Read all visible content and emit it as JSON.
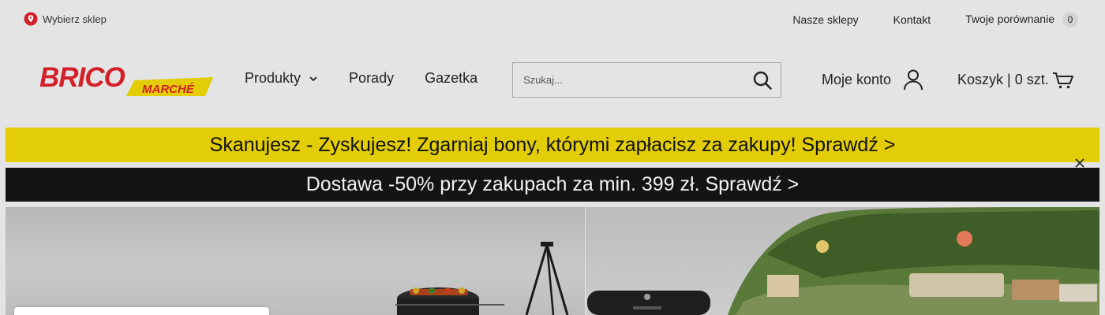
{
  "topbar": {
    "store_picker": "Wybierz sklep",
    "links": {
      "stores": "Nasze sklepy",
      "contact": "Kontakt",
      "compare": "Twoje porównanie",
      "compare_count": "0"
    }
  },
  "header": {
    "logo": {
      "text_main": "BRICO",
      "text_sub": "MARCHÉ"
    },
    "nav": {
      "products": "Produkty",
      "advice": "Porady",
      "leaflet": "Gazetka"
    },
    "search": {
      "placeholder": "Szukaj...",
      "value": ""
    },
    "account": "Moje konto",
    "cart": "Koszyk | 0 szt."
  },
  "banners": {
    "yellow": "Skanujesz - Zyskujesz! Zgarniaj bony, którymi zapłacisz za zakupy! Sprawdź >",
    "black": "Dostawa -50% przy zakupach za min. 399 zł. Sprawdź >"
  },
  "colors": {
    "brand_red": "#d3202a",
    "brand_yellow": "#e2cd07",
    "banner_black": "#141414",
    "background": "#e4e4e4"
  },
  "icons": [
    "location-pin-icon",
    "chevron-down-icon",
    "search-icon",
    "user-icon",
    "cart-icon",
    "close-icon"
  ]
}
